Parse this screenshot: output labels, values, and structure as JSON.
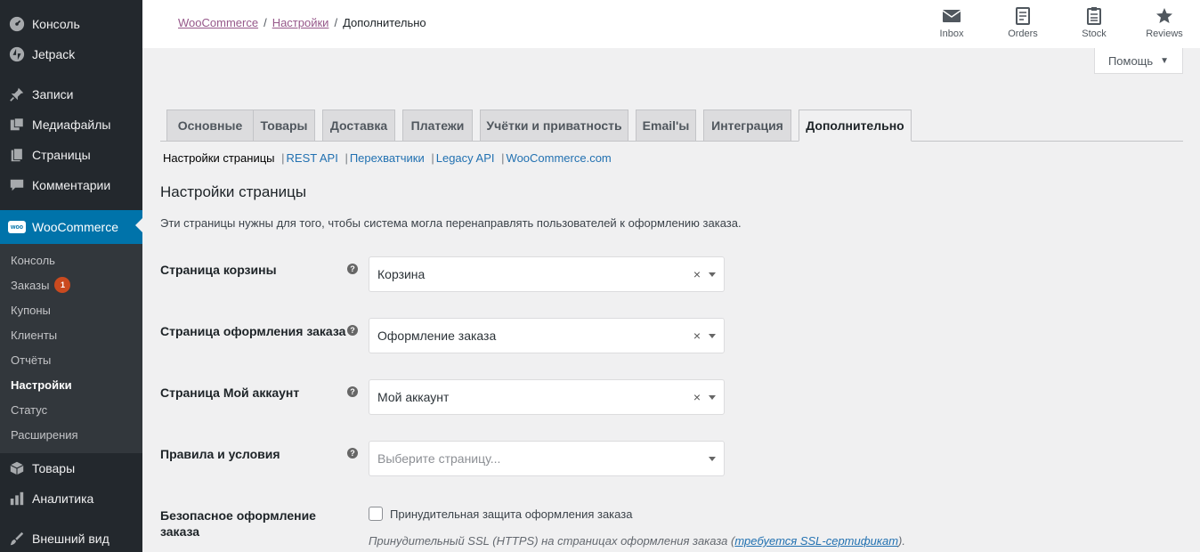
{
  "sidebar": {
    "top_items": [
      {
        "label": "Консоль",
        "icon": "dashboard-icon"
      },
      {
        "label": "Jetpack",
        "icon": "jetpack-icon"
      },
      {
        "label": "Записи",
        "icon": "pin-icon"
      },
      {
        "label": "Медиафайлы",
        "icon": "media-icon"
      },
      {
        "label": "Страницы",
        "icon": "pages-icon"
      },
      {
        "label": "Комментарии",
        "icon": "comments-icon"
      }
    ],
    "woocommerce": {
      "label": "WooCommerce",
      "icon_text": "woo"
    },
    "submenu": [
      {
        "label": "Консоль"
      },
      {
        "label": "Заказы",
        "badge": "1"
      },
      {
        "label": "Купоны"
      },
      {
        "label": "Клиенты"
      },
      {
        "label": "Отчёты"
      },
      {
        "label": "Настройки",
        "current": true
      },
      {
        "label": "Статус"
      },
      {
        "label": "Расширения"
      }
    ],
    "bottom_items": [
      {
        "label": "Товары",
        "icon": "box-icon"
      },
      {
        "label": "Аналитика",
        "icon": "analytics-icon"
      },
      {
        "label": "Внешний вид",
        "icon": "brush-icon"
      }
    ]
  },
  "breadcrumb": {
    "woocommerce": "WooCommerce",
    "settings": "Настройки",
    "current": "Дополнительно",
    "separator": "/"
  },
  "activity": {
    "inbox": "Inbox",
    "orders": "Orders",
    "stock": "Stock",
    "reviews": "Reviews"
  },
  "help": {
    "label": "Помощь"
  },
  "tabs": [
    {
      "label": "Основные"
    },
    {
      "label": "Товары"
    },
    {
      "label": "Доставка"
    },
    {
      "label": "Платежи"
    },
    {
      "label": "Учётки и приватность"
    },
    {
      "label": "Email'ы"
    },
    {
      "label": "Интеграция"
    },
    {
      "label": "Дополнительно",
      "active": true
    }
  ],
  "subnav": {
    "current": "Настройки страницы",
    "links": [
      "REST API",
      "Перехватчики",
      "Legacy API",
      "WooCommerce.com"
    ],
    "separator": "|"
  },
  "section": {
    "title": "Настройки страницы",
    "description": "Эти страницы нужны для того, чтобы система могла перенаправлять пользователей к оформлению заказа."
  },
  "fields": {
    "cart": {
      "label": "Страница корзины",
      "value": "Корзина",
      "clear": "×"
    },
    "checkout": {
      "label": "Страница оформления заказа",
      "value": "Оформление заказа",
      "clear": "×"
    },
    "myaccount": {
      "label": "Страница Мой аккаунт",
      "value": "Мой аккаунт",
      "clear": "×"
    },
    "terms": {
      "label": "Правила и условия",
      "placeholder": "Выберите страницу..."
    },
    "secure": {
      "label": "Безопасное оформление заказа",
      "checkbox_label": "Принудительная защита оформления заказа",
      "desc_before": "Принудительный SSL (HTTPS) на страницах оформления заказа (",
      "desc_link": "требуется SSL-сертификат",
      "desc_after": ")."
    }
  },
  "help_tip_glyph": "?",
  "colors": {
    "sidebar_bg": "#23282d",
    "active_menu": "#0073aa",
    "woo_purple": "#96588a",
    "link_blue": "#2271b1",
    "badge": "#ca4a1f"
  }
}
